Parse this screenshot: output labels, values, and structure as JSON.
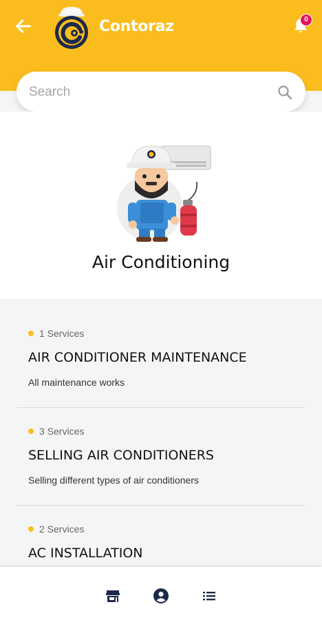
{
  "header": {
    "title": "Contoraz",
    "notification_count": "0",
    "background_color": "#fbbd1e"
  },
  "search": {
    "placeholder": "Search"
  },
  "category": {
    "title": "Air Conditioning"
  },
  "services": [
    {
      "count": "1 Services",
      "name": "AIR CONDITIONER MAINTENANCE",
      "description": "All maintenance works"
    },
    {
      "count": "3 Services",
      "name": "SELLING AIR CONDITIONERS",
      "description": "Selling different types of air conditioners"
    },
    {
      "count": "2 Services",
      "name": "AC INSTALLATION",
      "description": ""
    }
  ],
  "bottom_nav": {
    "items": [
      "store-icon",
      "account-icon",
      "list-icon"
    ]
  },
  "colors": {
    "accent": "#fbbd1e",
    "badge": "#e5155a",
    "icon_dark": "#1c2a4a"
  }
}
